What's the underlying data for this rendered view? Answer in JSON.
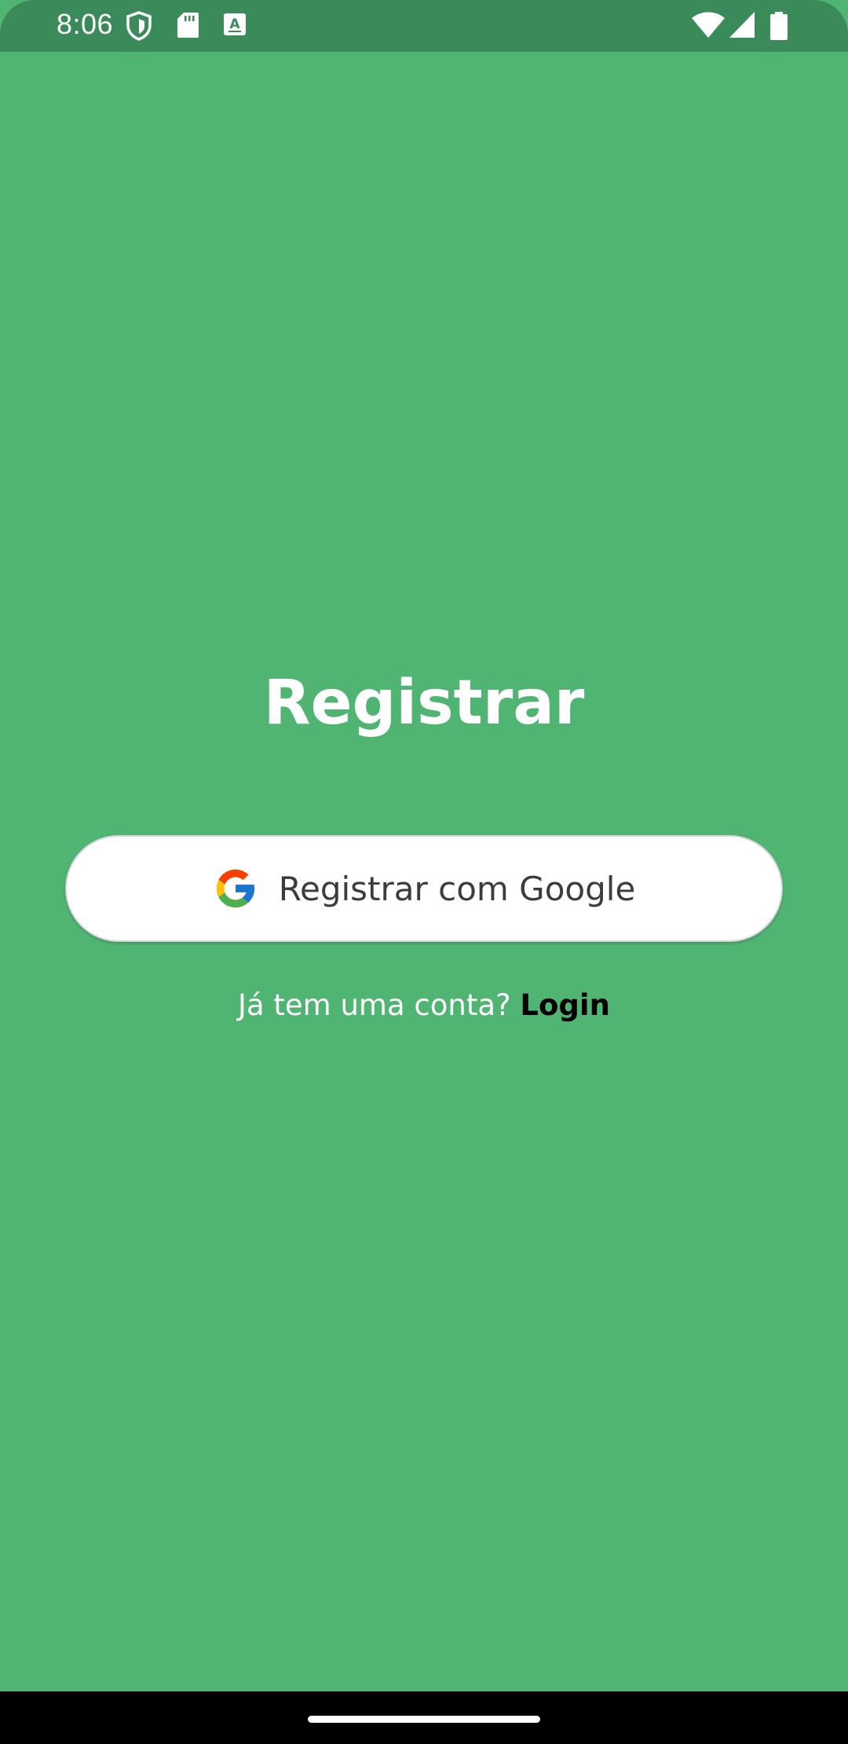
{
  "status_bar": {
    "time": "8:06",
    "left_icons": [
      "shield-icon",
      "sd-card-icon",
      "keyboard-a-icon"
    ],
    "right_icons": [
      "wifi-icon",
      "signal-icon",
      "battery-icon"
    ]
  },
  "screen": {
    "title": "Registrar",
    "google_button_label": "Registrar com Google",
    "google_button_icon": "google-g-icon",
    "login_prompt": "Já tem uma conta?",
    "login_link": "Login"
  },
  "colors": {
    "background": "#50B473",
    "status_bar": "#3A8A5A",
    "button_bg": "#FFFFFF",
    "link": "#000000"
  }
}
